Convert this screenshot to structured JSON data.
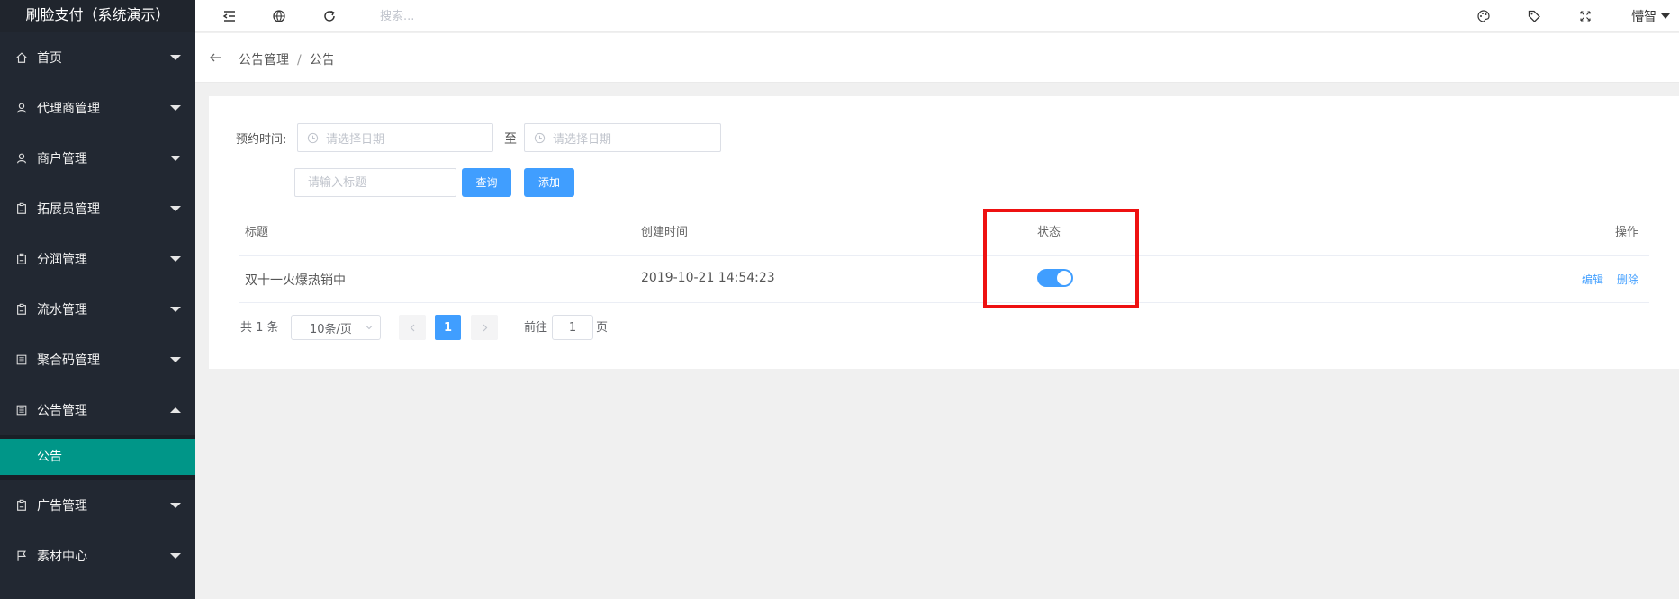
{
  "brand": "刷脸支付（系统演示）",
  "sidebar": {
    "items": [
      {
        "label": "首页",
        "icon": "home-icon"
      },
      {
        "label": "代理商管理",
        "icon": "user-icon"
      },
      {
        "label": "商户管理",
        "icon": "user-icon"
      },
      {
        "label": "拓展员管理",
        "icon": "clipboard-icon"
      },
      {
        "label": "分润管理",
        "icon": "clipboard-icon"
      },
      {
        "label": "流水管理",
        "icon": "clipboard-icon"
      },
      {
        "label": "聚合码管理",
        "icon": "list-icon"
      },
      {
        "label": "公告管理",
        "icon": "list-icon",
        "expanded": true
      },
      {
        "label": "广告管理",
        "icon": "clipboard-icon"
      },
      {
        "label": "素材中心",
        "icon": "flag-icon"
      }
    ],
    "submenu": {
      "label": "公告",
      "active": true
    }
  },
  "header": {
    "search_placeholder": "搜索...",
    "user": "懵智",
    "icons": [
      "collapse-menu-icon",
      "website-icon",
      "refresh-icon",
      "theme-palette-icon",
      "tag-icon",
      "fullscreen-icon"
    ]
  },
  "breadcrumb": {
    "parent": "公告管理",
    "separator": "/",
    "current": "公告"
  },
  "filters": {
    "time_label": "预约时间:",
    "start_placeholder": "请选择日期",
    "to_label": "至",
    "end_placeholder": "请选择日期",
    "title_placeholder": "请输入标题",
    "query_button": "查询",
    "add_button": "添加"
  },
  "table": {
    "columns": [
      "标题",
      "创建时间",
      "状态",
      "操作"
    ],
    "rows": [
      {
        "title": "双十一火爆热销中",
        "created": "2019-10-21 14:54:23",
        "status_on": true,
        "edit": "编辑",
        "delete": "删除"
      }
    ]
  },
  "pagination": {
    "total_text": "共 1 条",
    "page_size": "10条/页",
    "current_page": "1",
    "goto_label": "前往",
    "goto_value": "1",
    "page_suffix": "页"
  },
  "colors": {
    "sidebar_bg": "#222832",
    "active_submenu": "#009688",
    "primary": "#409eff",
    "highlight": "#ee1111"
  }
}
